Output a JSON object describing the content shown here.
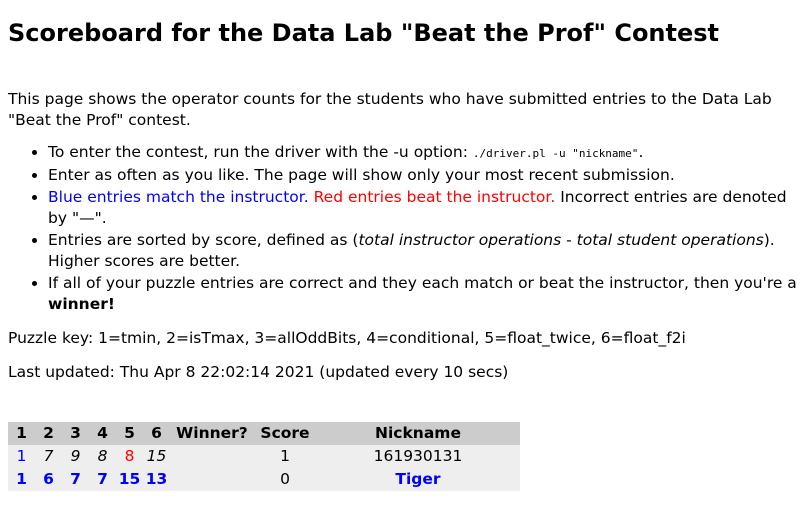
{
  "title": "Scoreboard for the Data Lab \"Beat the Prof\" Contest",
  "intro": "This page shows the operator counts for the students who have submitted entries to the Data Lab \"Beat the Prof\" contest.",
  "bullets": {
    "b1_text": "To enter the contest, run the driver with the -u option: ",
    "b1_code": "./driver.pl -u \"nickname\"",
    "b1_end": ".",
    "b2": "Enter as often as you like. The page will show only your most recent submission.",
    "b3_blue": "Blue entries match the instructor.",
    "b3_red": "Red entries beat the instructor.",
    "b3_rest": "Incorrect entries are denoted by \"—\".",
    "b4_pre": "Entries are sorted by score, defined as (",
    "b4_em1": "total instructor operations",
    "b4_mid": " - ",
    "b4_em2": "total student operations",
    "b4_post": "). Higher scores are better.",
    "b5_text": "If all of your puzzle entries are correct and they each match or beat the instructor, then you're a ",
    "b5_bold": "winner!"
  },
  "puzzle_key": "Puzzle key: 1=tmin, 2=isTmax, 3=allOddBits, 4=conditional, 5=float_twice, 6=float_f2i",
  "last_updated": "Last updated: Thu Apr 8 22:02:14 2021 (updated every 10 secs)",
  "table": {
    "headers": [
      "1",
      "2",
      "3",
      "4",
      "5",
      "6",
      "Winner?",
      "Score",
      "Nickname"
    ],
    "rows": [
      {
        "p1": "1",
        "p2": "7",
        "p3": "9",
        "p4": "8",
        "p5": "8",
        "p6": "15",
        "winner": "",
        "score": "1",
        "nickname": "161930131"
      },
      {
        "p1": "1",
        "p2": "6",
        "p3": "7",
        "p4": "7",
        "p5": "15",
        "p6": "13",
        "winner": "",
        "score": "0",
        "nickname": "Tiger"
      }
    ]
  },
  "colors": {
    "match": "#0000ff",
    "beat": "#ff0000",
    "header_bg": "#cccccc",
    "row_bg": "#eeeeee"
  }
}
